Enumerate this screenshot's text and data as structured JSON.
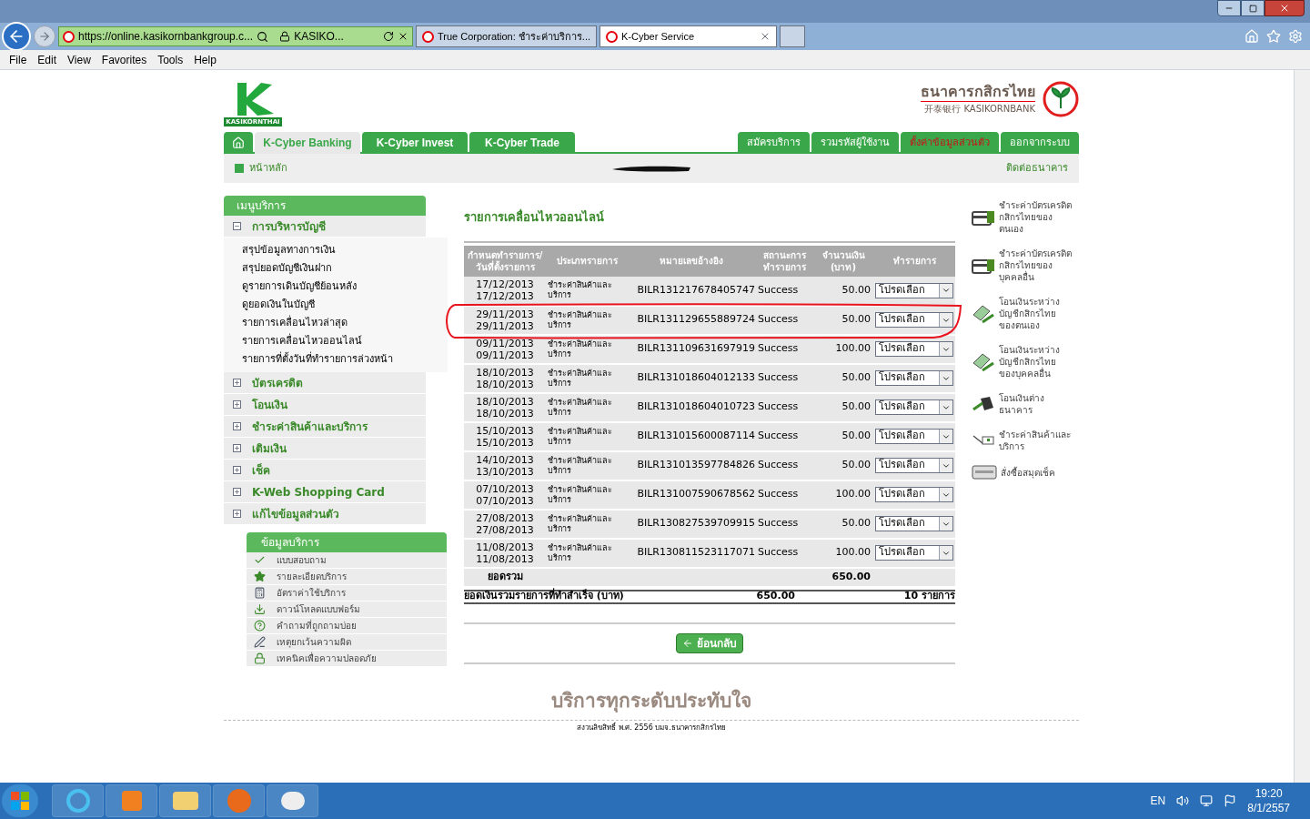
{
  "browser": {
    "address": "https://online.kasikornbankgroup.c...",
    "site_label": "KASIKO...",
    "tabs": [
      {
        "title": "True Corporation: ชำระค่าบริการ...",
        "selected": false,
        "closable": false
      },
      {
        "title": "K-Cyber Service",
        "selected": true,
        "closable": true
      }
    ],
    "menu": [
      "File",
      "Edit",
      "View",
      "Favorites",
      "Tools",
      "Help"
    ]
  },
  "header": {
    "logo_text": "KASIKORNTHAI",
    "bank_name": "ธนาคารกสิกรไทย",
    "bank_subname": "开泰银行 KASIKORNBANK"
  },
  "nav_left": [
    {
      "label": "K-Cyber Banking",
      "selected": true
    },
    {
      "label": "K-Cyber Invest",
      "selected": false
    },
    {
      "label": "K-Cyber Trade",
      "selected": false
    }
  ],
  "nav_right": [
    {
      "label": "สมัครบริการ",
      "emphasized": false
    },
    {
      "label": "รวมรหัสผู้ใช้งาน",
      "emphasized": false
    },
    {
      "label": "ตั้งค่าข้อมูลส่วนตัว",
      "emphasized": true
    },
    {
      "label": "ออกจากระบบ",
      "emphasized": false
    }
  ],
  "breadcrumb": {
    "home": "หน้าหลัก",
    "contact": "ติดต่อธนาคาร"
  },
  "menu_panel": {
    "title": "เมนูบริการ",
    "sections": [
      {
        "label": "การบริหารบัญชี",
        "expanded": true,
        "children": [
          "สรุปข้อมูลทางการเงิน",
          "สรุปยอดบัญชีเงินฝาก",
          "ดูรายการเดินบัญชีย้อนหลัง",
          "ดูยอดเงินในบัญชี",
          "รายการเคลื่อนไหวล่าสุด",
          "รายการเคลื่อนไหวออนไลน์",
          "รายการที่ตั้งวันที่ทำรายการล่วงหน้า"
        ]
      },
      {
        "label": "บัตรเครดิต",
        "expanded": false
      },
      {
        "label": "โอนเงิน",
        "expanded": false
      },
      {
        "label": "ชำระค่าสินค้าและบริการ",
        "expanded": false
      },
      {
        "label": "เติมเงิน",
        "expanded": false
      },
      {
        "label": "เช็ค",
        "expanded": false
      },
      {
        "label": "K-Web Shopping Card",
        "expanded": false
      },
      {
        "label": "แก้ไขข้อมูลส่วนตัว",
        "expanded": false
      }
    ]
  },
  "info_panel": {
    "title": "ข้อมูลบริการ",
    "items": [
      "แบบสอบถาม",
      "รายละเอียดบริการ",
      "อัตราค่าใช้บริการ",
      "ดาวน์โหลดแบบฟอร์ม",
      "คำถามที่ถูกถามบ่อย",
      "เหตุยกเว้นความผิด",
      "เทคนิคเพื่อความปลอดภัย"
    ]
  },
  "main": {
    "title": "รายการเคลื่อนไหวออนไลน์",
    "table": {
      "columns": [
        "กำหนดทำรายการ/ วันที่ตั้งรายการ",
        "ประเภทรายการ",
        "หมายเลขอ้างอิง",
        "สถานะการทำรายการ",
        "จำนวนเงิน (บาท)",
        "ทำรายการ"
      ],
      "rows": [
        {
          "date": "17/12/2013",
          "set_date": "17/12/2013",
          "type": "ชำระค่าสินค้าและบริการ",
          "ref": "BILR131217678405747",
          "status": "Success",
          "amount": "50.00",
          "action": "โปรดเลือก",
          "circled": false
        },
        {
          "date": "29/11/2013",
          "set_date": "29/11/2013",
          "type": "ชำระค่าสินค้าและบริการ",
          "ref": "BILR131129655889724",
          "status": "Success",
          "amount": "50.00",
          "action": "โปรดเลือก",
          "circled": true
        },
        {
          "date": "09/11/2013",
          "set_date": "09/11/2013",
          "type": "ชำระค่าสินค้าและบริการ",
          "ref": "BILR131109631697919",
          "status": "Success",
          "amount": "100.00",
          "action": "โปรดเลือก",
          "circled": false
        },
        {
          "date": "18/10/2013",
          "set_date": "18/10/2013",
          "type": "ชำระค่าสินค้าและบริการ",
          "ref": "BILR131018604012133",
          "status": "Success",
          "amount": "50.00",
          "action": "โปรดเลือก",
          "circled": false
        },
        {
          "date": "18/10/2013",
          "set_date": "18/10/2013",
          "type": "ชำระค่าสินค้าและบริการ",
          "ref": "BILR131018604010723",
          "status": "Success",
          "amount": "50.00",
          "action": "โปรดเลือก",
          "circled": false
        },
        {
          "date": "15/10/2013",
          "set_date": "15/10/2013",
          "type": "ชำระค่าสินค้าและบริการ",
          "ref": "BILR131015600087114",
          "status": "Success",
          "amount": "50.00",
          "action": "โปรดเลือก",
          "circled": false
        },
        {
          "date": "14/10/2013",
          "set_date": "13/10/2013",
          "type": "ชำระค่าสินค้าและบริการ",
          "ref": "BILR131013597784826",
          "status": "Success",
          "amount": "50.00",
          "action": "โปรดเลือก",
          "circled": false
        },
        {
          "date": "07/10/2013",
          "set_date": "07/10/2013",
          "type": "ชำระค่าสินค้าและบริการ",
          "ref": "BILR131007590678562",
          "status": "Success",
          "amount": "100.00",
          "action": "โปรดเลือก",
          "circled": false
        },
        {
          "date": "27/08/2013",
          "set_date": "27/08/2013",
          "type": "ชำระค่าสินค้าและบริการ",
          "ref": "BILR130827539709915",
          "status": "Success",
          "amount": "50.00",
          "action": "โปรดเลือก",
          "circled": false
        },
        {
          "date": "11/08/2013",
          "set_date": "11/08/2013",
          "type": "ชำระค่าสินค้าและบริการ",
          "ref": "BILR130811523117071",
          "status": "Success",
          "amount": "100.00",
          "action": "โปรดเลือก",
          "circled": false
        }
      ],
      "total": {
        "label": "ยอดรวม",
        "amount": "650.00"
      },
      "summary": {
        "label": "ยอดเงินรวมรายการที่ทำสำเร็จ (บาท)",
        "amount": "650.00",
        "count": "10 รายการ"
      }
    },
    "back_button": "ย้อนกลับ"
  },
  "shortcuts": [
    {
      "label": "ชำระค่าบัตรเครดิตกสิกรไทยของตนเอง",
      "kind": "card"
    },
    {
      "label": "ชำระค่าบัตรเครดิตกสิกรไทยของบุคคลอื่น",
      "kind": "card"
    },
    {
      "label": "โอนเงินระหว่างบัญชีกสิกรไทยของตนเอง",
      "kind": "transfer"
    },
    {
      "label": "โอนเงินระหว่างบัญชีกสิกรไทยของบุคคลอื่น",
      "kind": "transfer"
    },
    {
      "label": "โอนเงินต่างธนาคาร",
      "kind": "book"
    },
    {
      "label": "ชำระค่าสินค้าและบริการ",
      "kind": "pay"
    },
    {
      "label": "สั่งซื้อสมุดเช็ค",
      "kind": "cheque"
    }
  ],
  "footer": {
    "slogan": "บริการทุกระดับประทับใจ",
    "copyright": "สงวนลิขสิทธิ์ พ.ศ. 2556 บมจ.ธนาคารกสิกรไทย"
  },
  "taskbar": {
    "language": "EN",
    "time": "19:20",
    "date": "8/1/2557"
  }
}
